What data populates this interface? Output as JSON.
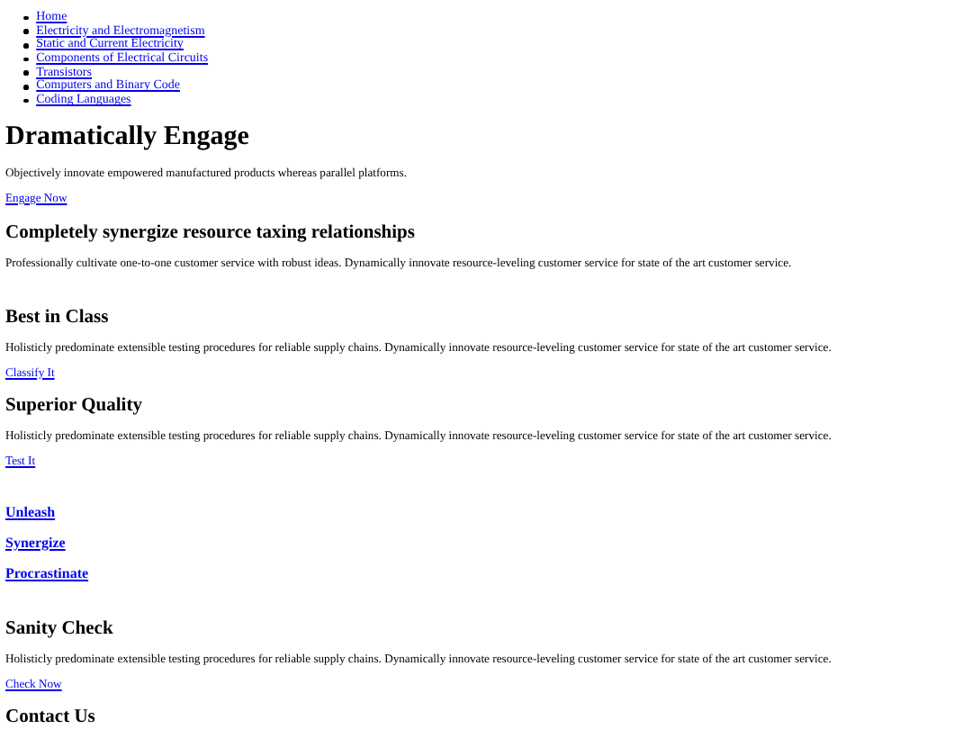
{
  "nav": [
    {
      "label": "Home"
    },
    {
      "label": "Electricity and Electromagnetism"
    },
    {
      "label": "Static and Current Electricity"
    },
    {
      "label": "Components of Electrical Circuits"
    },
    {
      "label": "Transistors"
    },
    {
      "label": "Computers and Binary Code"
    },
    {
      "label": "Coding Languages"
    }
  ],
  "sections": [
    {
      "blocks": [
        {
          "kind": "title",
          "text": "Dramatically Engage"
        },
        {
          "kind": "text",
          "text": "Objectively innovate empowered manufactured products whereas parallel platforms."
        },
        {
          "kind": "link",
          "text": "Engage Now"
        }
      ]
    },
    {
      "blocks": [
        {
          "kind": "heading",
          "text": "Completely synergize resource taxing relationships"
        },
        {
          "kind": "text",
          "text": "Professionally cultivate one-to-one customer service with robust ideas. Dynamically innovate resource-leveling customer service for state of the art customer service."
        }
      ]
    },
    {
      "blocks": [
        {
          "kind": "heading",
          "text": "Best in Class"
        },
        {
          "kind": "text",
          "text": "Holisticly predominate extensible testing procedures for reliable supply chains. Dynamically innovate resource-leveling customer service for state of the art customer service."
        },
        {
          "kind": "link",
          "text": "Classify It"
        },
        {
          "kind": "heading",
          "text": "Superior Quality"
        },
        {
          "kind": "text",
          "text": "Holisticly predominate extensible testing procedures for reliable supply chains. Dynamically innovate resource-leveling customer service for state of the art customer service."
        },
        {
          "kind": "link",
          "text": "Test It"
        }
      ]
    },
    {
      "blocks": [
        {
          "kind": "action",
          "text": "Unleash"
        },
        {
          "kind": "action",
          "text": "Synergize"
        },
        {
          "kind": "action",
          "text": "Procrastinate"
        }
      ]
    },
    {
      "blocks": [
        {
          "kind": "heading",
          "text": "Sanity Check"
        },
        {
          "kind": "text",
          "text": "Holisticly predominate extensible testing procedures for reliable supply chains. Dynamically innovate resource-leveling customer service for state of the art customer service."
        },
        {
          "kind": "link",
          "text": "Check Now"
        },
        {
          "kind": "heading",
          "text": "Contact Us"
        }
      ]
    }
  ]
}
